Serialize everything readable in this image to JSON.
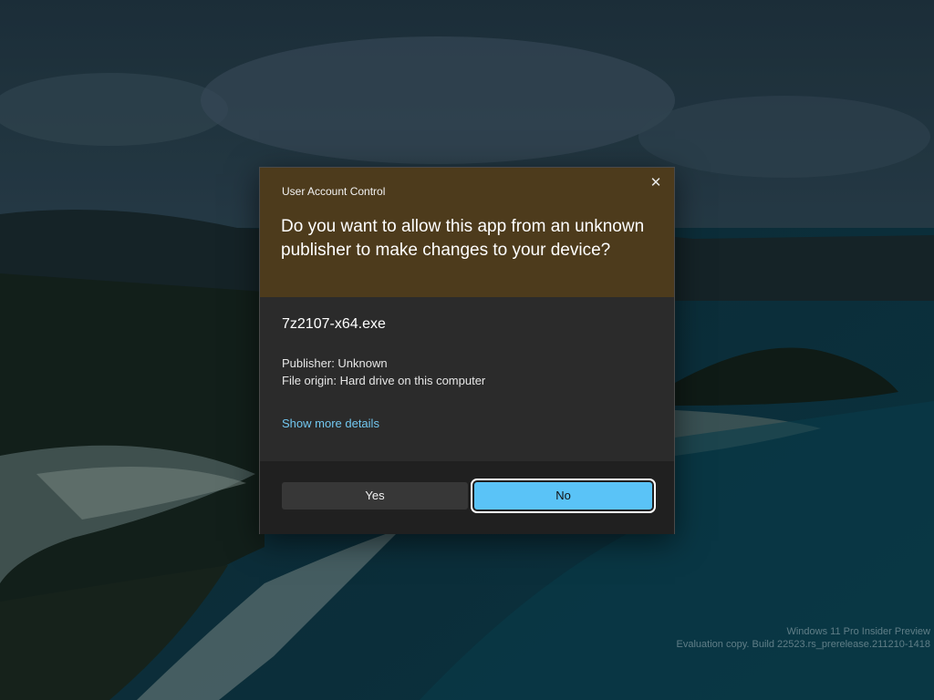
{
  "dialog": {
    "title": "User Account Control",
    "close_icon": "close-icon",
    "question": "Do you want to allow this app from an unknown publisher to make changes to your device?",
    "app_name": "7z2107-x64.exe",
    "publisher": "Publisher: Unknown",
    "file_origin": "File origin: Hard drive on this computer",
    "details_link": "Show more details",
    "yes_label": "Yes",
    "no_label": "No",
    "header_color": "#4d3b1c",
    "accent_color": "#5ac3f7"
  },
  "watermark": {
    "line1": "Windows 11 Pro Insider Preview",
    "line2": "Evaluation copy. Build 22523.rs_prerelease.211210-1418"
  }
}
